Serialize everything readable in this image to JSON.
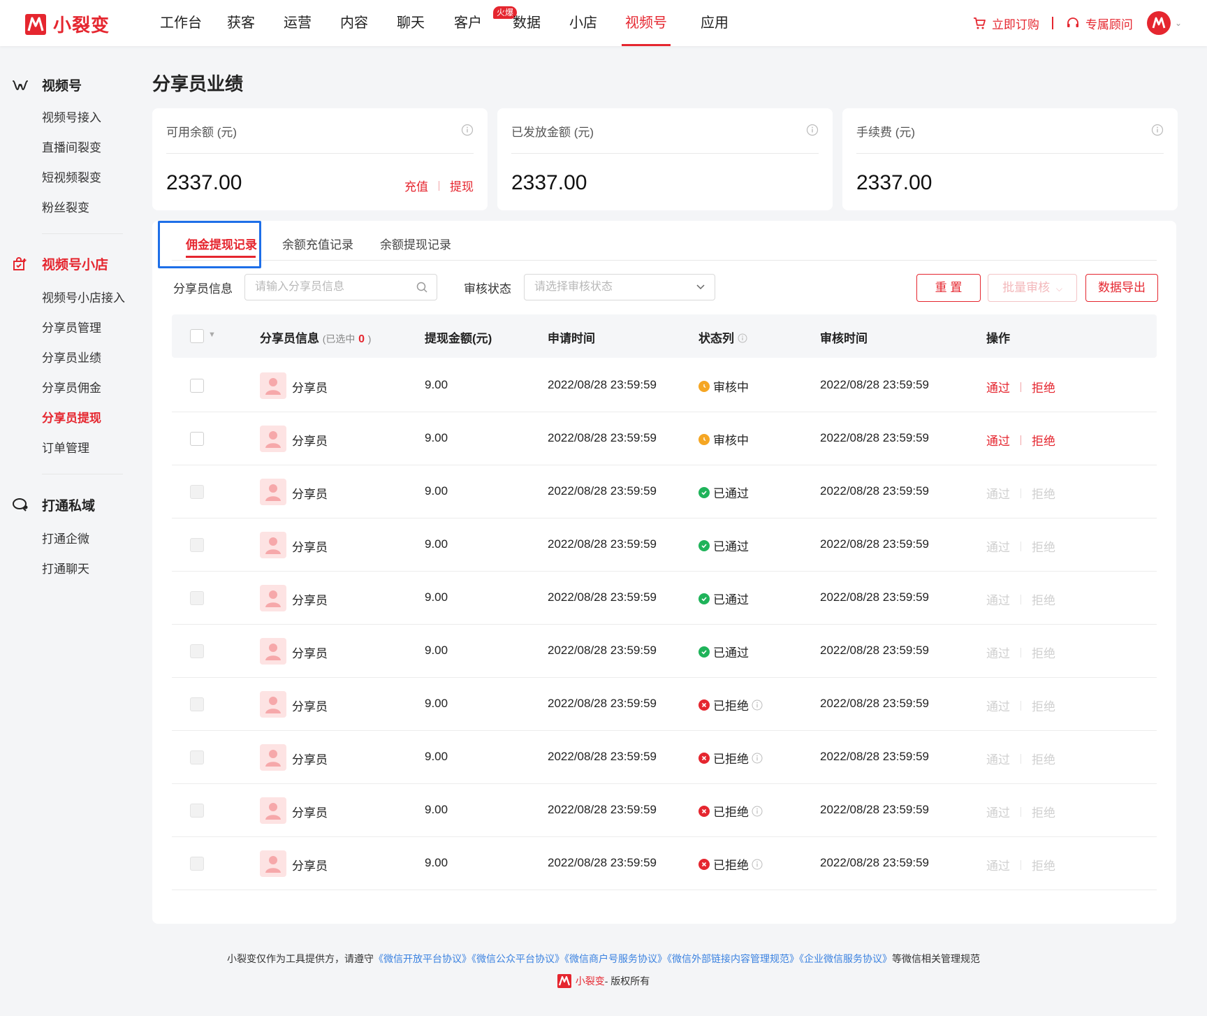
{
  "brand": {
    "name": "小裂变",
    "accent": "#e5262f"
  },
  "nav": {
    "items": [
      "工作台",
      "获客",
      "运营",
      "内容",
      "聊天",
      "客户",
      "数据",
      "小店",
      "视频号",
      "应用"
    ],
    "hot_badge": "火爆",
    "active": "视频号"
  },
  "top_right": {
    "buy_label": "立即订购",
    "advisor_label": "专属顾问"
  },
  "sidebar": {
    "group1": {
      "title": "视频号",
      "items": [
        "视频号接入",
        "直播间裂变",
        "短视频裂变",
        "粉丝裂变"
      ]
    },
    "group2": {
      "title": "视频号小店",
      "items": [
        "视频号小店接入",
        "分享员管理",
        "分享员业绩",
        "分享员佣金",
        "分享员提现",
        "订单管理"
      ]
    },
    "group3": {
      "title": "打通私域",
      "items": [
        "打通企微",
        "打通聊天"
      ]
    },
    "active_item": "分享员提现"
  },
  "page": {
    "title": "分享员业绩"
  },
  "cards": [
    {
      "label": "可用余额 (元)",
      "value": "2337.00",
      "actions": [
        "充值",
        "提现"
      ]
    },
    {
      "label": "已发放金额 (元)",
      "value": "2337.00"
    },
    {
      "label": "手续费 (元)",
      "value": "2337.00"
    }
  ],
  "tabs": [
    "佣金提现记录",
    "余额充值记录",
    "余额提现记录"
  ],
  "filters": {
    "sharer_label": "分享员信息",
    "sharer_placeholder": "请输入分享员信息",
    "status_label": "审核状态",
    "status_placeholder": "请选择审核状态",
    "reset": "重 置",
    "batch": "批量审核",
    "export": "数据导出"
  },
  "table": {
    "headers": {
      "sharer": "分享员信息",
      "selected_prefix": "(已选中",
      "selected_count": "0",
      "selected_suffix": ")",
      "amount": "提现金额(元)",
      "apply_time": "申请时间",
      "status": "状态列",
      "review_time": "审核时间",
      "action": "操作"
    },
    "action_labels": {
      "approve": "通过",
      "reject": "拒绝"
    },
    "rows": [
      {
        "name": "分享员",
        "amount": "9.00",
        "apply_time": "2022/08/28 23:59:59",
        "status": "审核中",
        "status_type": "pending",
        "review_time": "2022/08/28 23:59:59"
      },
      {
        "name": "分享员",
        "amount": "9.00",
        "apply_time": "2022/08/28 23:59:59",
        "status": "审核中",
        "status_type": "pending",
        "review_time": "2022/08/28 23:59:59"
      },
      {
        "name": "分享员",
        "amount": "9.00",
        "apply_time": "2022/08/28 23:59:59",
        "status": "已通过",
        "status_type": "approved",
        "review_time": "2022/08/28 23:59:59"
      },
      {
        "name": "分享员",
        "amount": "9.00",
        "apply_time": "2022/08/28 23:59:59",
        "status": "已通过",
        "status_type": "approved",
        "review_time": "2022/08/28 23:59:59"
      },
      {
        "name": "分享员",
        "amount": "9.00",
        "apply_time": "2022/08/28 23:59:59",
        "status": "已通过",
        "status_type": "approved",
        "review_time": "2022/08/28 23:59:59"
      },
      {
        "name": "分享员",
        "amount": "9.00",
        "apply_time": "2022/08/28 23:59:59",
        "status": "已通过",
        "status_type": "approved",
        "review_time": "2022/08/28 23:59:59"
      },
      {
        "name": "分享员",
        "amount": "9.00",
        "apply_time": "2022/08/28 23:59:59",
        "status": "已拒绝",
        "status_type": "rejected",
        "review_time": "2022/08/28 23:59:59"
      },
      {
        "name": "分享员",
        "amount": "9.00",
        "apply_time": "2022/08/28 23:59:59",
        "status": "已拒绝",
        "status_type": "rejected",
        "review_time": "2022/08/28 23:59:59"
      },
      {
        "name": "分享员",
        "amount": "9.00",
        "apply_time": "2022/08/28 23:59:59",
        "status": "已拒绝",
        "status_type": "rejected",
        "review_time": "2022/08/28 23:59:59"
      },
      {
        "name": "分享员",
        "amount": "9.00",
        "apply_time": "2022/08/28 23:59:59",
        "status": "已拒绝",
        "status_type": "rejected",
        "review_time": "2022/08/28 23:59:59"
      }
    ]
  },
  "footer": {
    "prefix": "小裂变仅作为工具提供方，请遵守",
    "links": [
      "《微信开放平台协议》",
      "《微信公众平台协议》",
      "《微信商户号服务协议》",
      "《微信外部链接内容管理规范》",
      "《企业微信服务协议》"
    ],
    "suffix": "等微信相关管理规范",
    "copyright_brand": "小裂变",
    "copyright_text": " - 版权所有"
  },
  "colors": {
    "pending": "#f5a623",
    "approved": "#1fb35a",
    "rejected": "#e5262f",
    "tab_focus": "#1e6fe8"
  }
}
